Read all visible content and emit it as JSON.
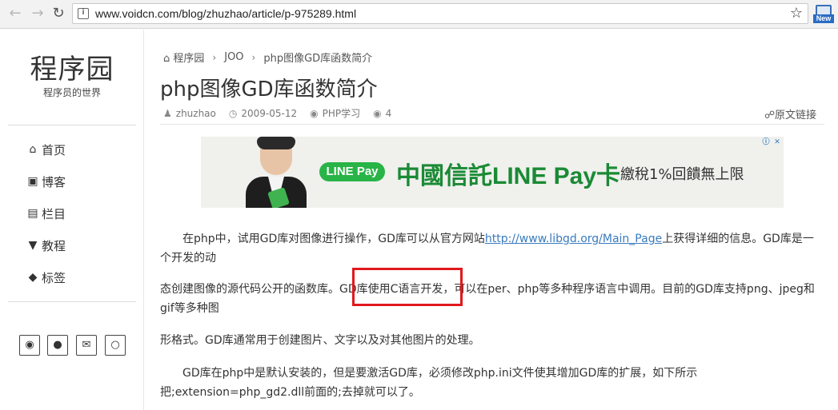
{
  "browser": {
    "url": "www.voidcn.com/blog/zhuzhao/article/p-975289.html",
    "back_icon": "arrow-left",
    "forward_icon": "arrow-right",
    "reload_icon": "reload",
    "star_icon": "star",
    "extension_badge": "New"
  },
  "sidebar": {
    "brand": "程序园",
    "subtitle": "程序员的世界",
    "items": [
      {
        "label": "首页",
        "icon": "home"
      },
      {
        "label": "博客",
        "icon": "camera"
      },
      {
        "label": "栏目",
        "icon": "film"
      },
      {
        "label": "教程",
        "icon": "filter"
      },
      {
        "label": "标签",
        "icon": "tag"
      }
    ],
    "social": [
      "weibo",
      "qq",
      "email",
      "wechat"
    ]
  },
  "breadcrumb": {
    "home": "程序园",
    "section": "JOO",
    "current": "php图像GD库函数简介"
  },
  "article": {
    "title": "php图像GD库函数简介",
    "author": "zhuzhao",
    "date": "2009-05-12",
    "category": "PHP学习",
    "views": "4",
    "source_link": "原文链接",
    "p1_before": "在php中，试用GD库对图像进行操作，GD库可以从官方网站",
    "p1_link": "http://www.libgd.org/Main_Page",
    "p1_after": "上获得详细的信息。GD库是一个开发的动",
    "p2": "态创建图像的源代码公开的函数库。GD库使用C语言开发，可以在per、php等多种程序语言中调用。目前的GD库支持png、jpeg和gif等多种图",
    "p3": "形格式。GD库通常用于创建图片、文字以及对其他图片的处理。",
    "p4": "GD库在php中是默认安装的，但是要激活GD库，必须修改php.ini文件使其增加GD库的扩展，如下所示把;extension=php_gd2.dll前面的;去掉就可以了。"
  },
  "ad": {
    "badge": "LINE Pay",
    "headline": "中國信託LINE Pay卡",
    "subline": "繳稅1%回饋無上限"
  },
  "annotation": {
    "color": "#e0191e"
  }
}
